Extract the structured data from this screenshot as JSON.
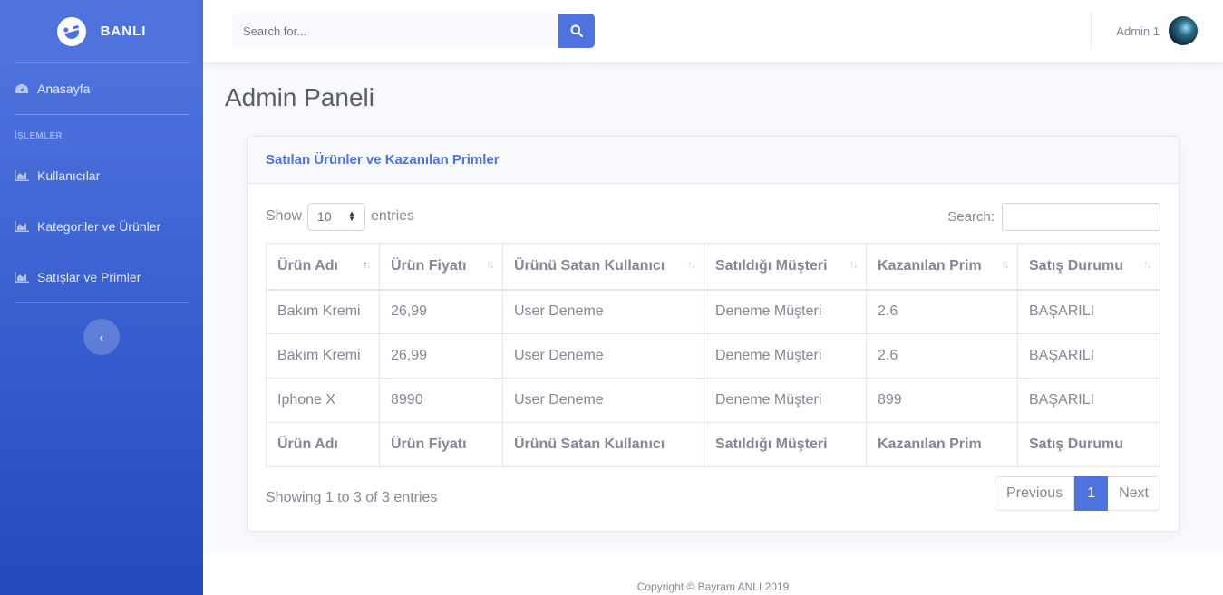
{
  "brand": {
    "name": "BANLI"
  },
  "sidebar": {
    "dashboard_label": "Anasayfa",
    "heading": "İŞLEMLER",
    "items": [
      {
        "label": "Kullanıcılar"
      },
      {
        "label": "Kategoriler ve Ürünler"
      },
      {
        "label": "Satışlar ve Primler"
      }
    ],
    "toggle_icon": "chevron-left-icon"
  },
  "topbar": {
    "search_placeholder": "Search for...",
    "user_name": "Admin 1"
  },
  "page": {
    "title": "Admin Paneli"
  },
  "card": {
    "title": "Satılan Ürünler ve Kazanılan Primler",
    "show_label": "Show",
    "page_size": "10",
    "entries_label": "entries",
    "search_label": "Search:",
    "columns": [
      "Ürün Adı",
      "Ürün Fiyatı",
      "Ürünü Satan Kullanıcı",
      "Satıldığı Müşteri",
      "Kazanılan Prim",
      "Satış Durumu"
    ],
    "rows": [
      [
        "Bakım Kremi",
        "26,99",
        "User Deneme",
        "Deneme Müşteri",
        "2.6",
        "BAŞARILI"
      ],
      [
        "Bakım Kremi",
        "26,99",
        "User Deneme",
        "Deneme Müşteri",
        "2.6",
        "BAŞARILI"
      ],
      [
        "Iphone X",
        "8990",
        "User Deneme",
        "Deneme Müşteri",
        "899",
        "BAŞARILI"
      ]
    ],
    "info": "Showing 1 to 3 of 3 entries",
    "pagination": {
      "previous": "Previous",
      "current": "1",
      "next": "Next"
    }
  },
  "footer": {
    "text": "Copyright © Bayram ANLI 2019"
  },
  "colors": {
    "primary": "#4e73df",
    "primary_dark": "#224abe",
    "text": "#858796"
  }
}
